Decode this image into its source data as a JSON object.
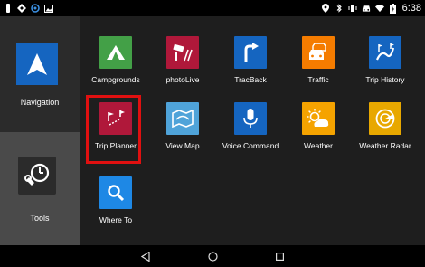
{
  "status_bar": {
    "time": "6:38",
    "left_icons": [
      "notification-dot-icon",
      "navigation-diamond-icon",
      "app-sync-icon",
      "image-icon"
    ],
    "right_icons": [
      "location-pin-icon",
      "bluetooth-icon",
      "vibrate-icon",
      "car-icon",
      "wifi-icon",
      "battery-icon"
    ]
  },
  "sidebar": {
    "navigation": {
      "label": "Navigation",
      "icon": "navigation-arrow-icon",
      "color": "#1565c0"
    },
    "tools": {
      "label": "Tools",
      "icon": "tools-clock-icon"
    }
  },
  "apps": [
    {
      "label": "Campgrounds",
      "icon": "campground-tent-icon",
      "color": "#43a047"
    },
    {
      "label": "photoLive",
      "icon": "traffic-camera-icon",
      "color": "#b0183a"
    },
    {
      "label": "TracBack",
      "icon": "tracback-arrow-icon",
      "color": "#1565c0"
    },
    {
      "label": "Traffic",
      "icon": "traffic-car-icon",
      "color": "#f57c00"
    },
    {
      "label": "Trip History",
      "icon": "trip-history-icon",
      "color": "#1565c0"
    },
    {
      "label": "Trip Planner",
      "icon": "trip-planner-icon",
      "color": "#b0183a"
    },
    {
      "label": "View Map",
      "icon": "map-icon",
      "color": "#4fa3d9"
    },
    {
      "label": "Voice Command",
      "icon": "microphone-icon",
      "color": "#1565c0"
    },
    {
      "label": "Weather",
      "icon": "weather-sun-icon",
      "color": "#f5a300"
    },
    {
      "label": "Weather Radar",
      "icon": "weather-radar-icon",
      "color": "#e8a800"
    },
    {
      "label": "Where To",
      "icon": "search-magnifier-icon",
      "color": "#1e88e5"
    }
  ],
  "selected_app": "Trip Planner",
  "nav_bar": {
    "buttons": [
      "back-triangle-icon",
      "home-circle-icon",
      "recents-square-icon"
    ]
  }
}
